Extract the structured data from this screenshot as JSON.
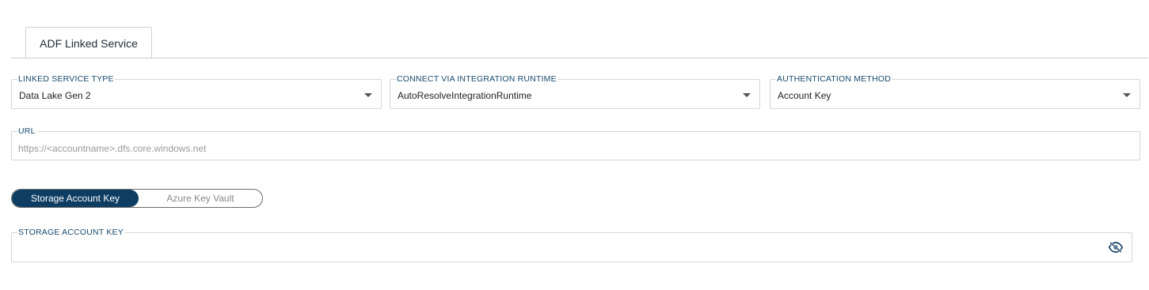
{
  "tabs": [
    {
      "label": "ADF Linked Service"
    }
  ],
  "fields": {
    "linked_service_type": {
      "label": "LINKED SERVICE TYPE",
      "value": "Data Lake Gen 2"
    },
    "integration_runtime": {
      "label": "CONNECT VIA INTEGRATION RUNTIME",
      "value": "AutoResolveIntegrationRuntime"
    },
    "auth_method": {
      "label": "AUTHENTICATION METHOD",
      "value": "Account Key"
    },
    "url": {
      "label": "URL",
      "placeholder": "https://<accountname>.dfs.core.windows.net",
      "value": ""
    },
    "storage_account_key": {
      "label": "STORAGE ACCOUNT KEY",
      "value": ""
    }
  },
  "key_source_toggle": {
    "options": [
      "Storage Account Key",
      "Azure Key Vault"
    ],
    "selected": "Storage Account Key"
  },
  "icons": {
    "dropdown": "chevron-down-icon",
    "visibility": "eye-off-icon"
  },
  "colors": {
    "accent": "#0e3d63",
    "label": "#174a6e",
    "border": "#d6d6d6"
  }
}
